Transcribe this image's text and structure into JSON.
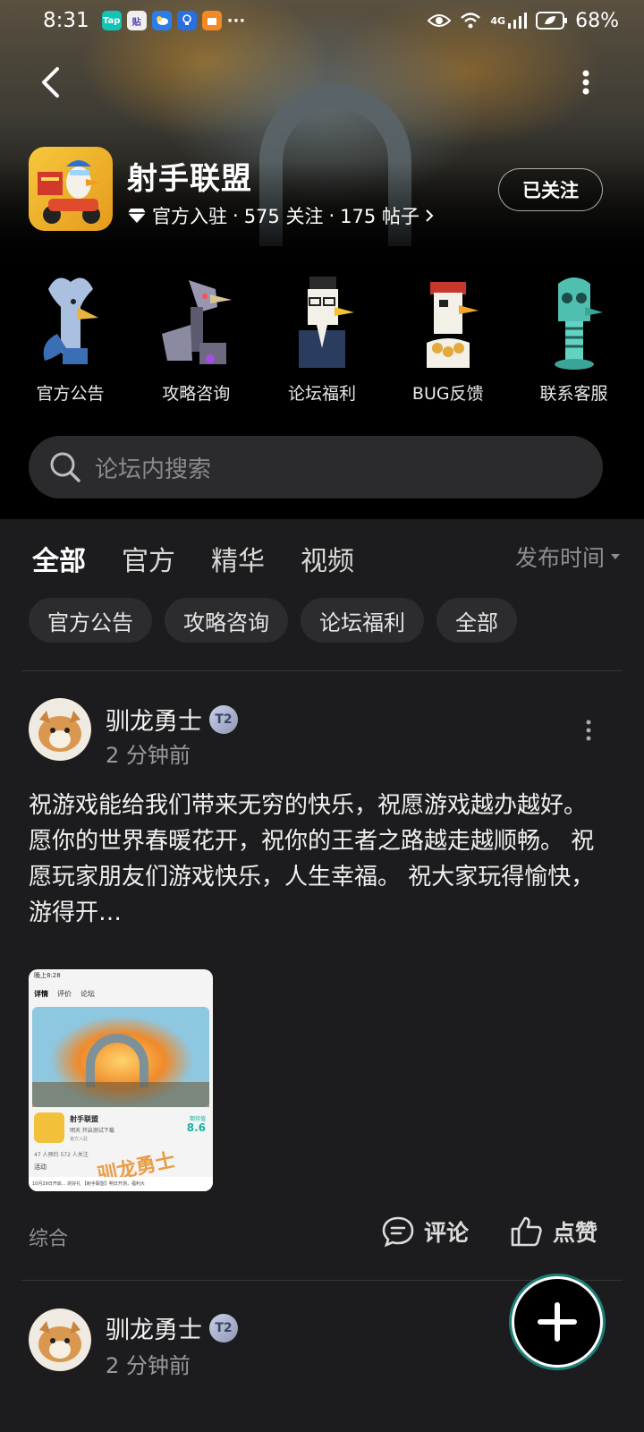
{
  "status_bar": {
    "time": "8:31",
    "apps": [
      "Tap",
      "贴"
    ],
    "more": "···",
    "network": "4G",
    "battery": "68%"
  },
  "forum": {
    "title": "射手联盟",
    "meta": {
      "official": "官方入驻",
      "followers": "575 关注",
      "posts": "175 帖子"
    },
    "follow_label": "已关注"
  },
  "shortcuts": [
    {
      "label": "官方公告",
      "icon": "ghost-goose-icon",
      "color": "#9fb6d8"
    },
    {
      "label": "攻略咨询",
      "icon": "robot-goose-icon",
      "color": "#8e8aa6"
    },
    {
      "label": "论坛福利",
      "icon": "glasses-goose-icon",
      "color": "#f2d05a"
    },
    {
      "label": "BUG反馈",
      "icon": "pirate-goose-icon",
      "color": "#e8e2d8"
    },
    {
      "label": "联系客服",
      "icon": "zombie-goose-icon",
      "color": "#58c9b9"
    }
  ],
  "search": {
    "placeholder": "论坛内搜索"
  },
  "tabs": [
    {
      "label": "全部",
      "active": true
    },
    {
      "label": "官方",
      "active": false
    },
    {
      "label": "精华",
      "active": false
    },
    {
      "label": "视频",
      "active": false
    }
  ],
  "sort_label": "发布时间",
  "chips": [
    "官方公告",
    "攻略咨询",
    "论坛福利",
    "全部"
  ],
  "posts": [
    {
      "author": "驯龙勇士",
      "level": "2",
      "time": "2 分钟前",
      "body": "祝游戏能给我们带来无穷的快乐，祝愿游戏越办越好。 愿你的世界春暖花开，祝你的王者之路越走越顺畅。 祝愿玩家朋友们游戏快乐，人生幸福。 祝大家玩得愉快，游得开…",
      "category": "综合",
      "comment_label": "评论",
      "like_label": "点赞",
      "thumbnail": {
        "status_time": "晚上8:28",
        "nav": [
          "详情",
          "评价",
          "论坛"
        ],
        "game_name": "射手联盟",
        "game_sub": "明天 开启测试下载",
        "official": "官方入驻",
        "score_label": "期待值",
        "score": "8.6",
        "stats": "47 人预约   572 人关注",
        "activity": "活动",
        "watermark": "驯龙勇士",
        "banner": "10月29日开启… 的好礼 【射手联盟】明日开测，福利大"
      }
    },
    {
      "author": "驯龙勇士",
      "level": "2",
      "time": "2 分钟前"
    }
  ],
  "colors": {
    "accent": "#19c3b0",
    "background": "#1c1c1e",
    "chip": "#2c2c2e"
  }
}
